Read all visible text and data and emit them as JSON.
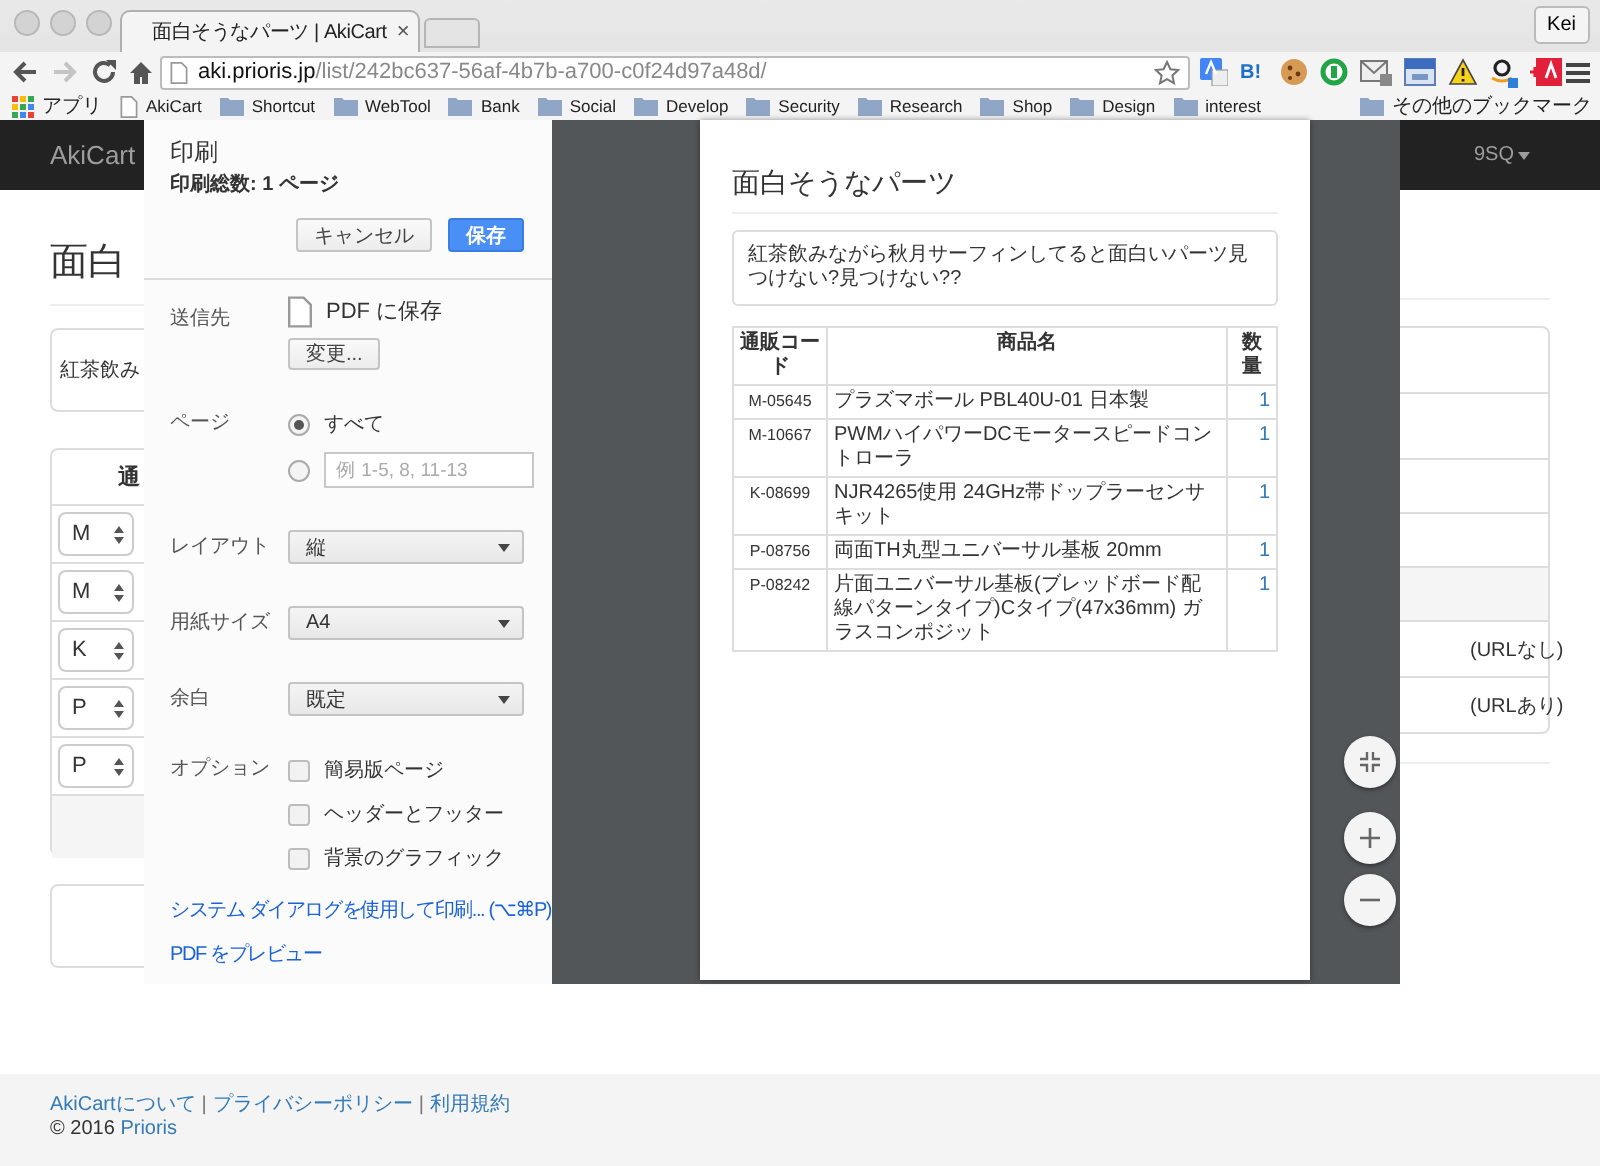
{
  "browser": {
    "tab": {
      "title": "面白そうなパーツ | AkiCart",
      "close": "×"
    },
    "profile": "Kei",
    "forward_disabled": true,
    "address": {
      "host": "aki.prioris.jp",
      "path": "/list/242bc637-56af-4b7b-a700-c0f24d97a48d/"
    },
    "extensions": [
      {
        "kind": "translate"
      },
      {
        "kind": "hatena",
        "label": "B!"
      },
      {
        "kind": "cookie"
      },
      {
        "kind": "ring"
      },
      {
        "kind": "mail"
      },
      {
        "kind": "calendar"
      },
      {
        "kind": "warning"
      },
      {
        "kind": "smile"
      },
      {
        "kind": "redtag"
      }
    ],
    "bookmarks": [
      {
        "kind": "apps",
        "label": "アプリ"
      },
      {
        "kind": "page",
        "label": "AkiCart"
      },
      {
        "kind": "folder",
        "label": "Shortcut"
      },
      {
        "kind": "folder",
        "label": "WebTool"
      },
      {
        "kind": "folder",
        "label": "Bank"
      },
      {
        "kind": "folder",
        "label": "Social"
      },
      {
        "kind": "folder",
        "label": "Develop"
      },
      {
        "kind": "folder",
        "label": "Security"
      },
      {
        "kind": "folder",
        "label": "Research"
      },
      {
        "kind": "folder",
        "label": "Shop"
      },
      {
        "kind": "folder",
        "label": "Design"
      },
      {
        "kind": "folder",
        "label": "interest"
      }
    ],
    "other_bookmarks": "その他のブックマーク"
  },
  "page": {
    "brand": "AkiCart",
    "user_menu": "9SQ",
    "title": "面白",
    "description": "紅茶飲み",
    "table_header": "通",
    "codes": [
      "M",
      "M",
      "K",
      "P",
      "P"
    ],
    "notes": [
      "(URLなし)",
      "(URLあり)"
    ],
    "footer": {
      "items": [
        {
          "kind": "link",
          "text": "AkiCartについて"
        },
        {
          "kind": "separator",
          "text": "|"
        },
        {
          "kind": "link",
          "text": "プライバシーポリシー"
        },
        {
          "kind": "separator",
          "text": "|"
        },
        {
          "kind": "link",
          "text": "利用規約"
        }
      ],
      "copyright": "© 2016",
      "company": "Prioris"
    }
  },
  "print": {
    "title": "印刷",
    "total": "印刷総数: 1 ページ",
    "buttons": [
      {
        "label": "キャンセル",
        "primary": false
      },
      {
        "label": "保存",
        "primary": true
      }
    ],
    "destination": {
      "label": "送信先",
      "value": "PDF に保存",
      "change": "変更..."
    },
    "pages": {
      "label": "ページ",
      "options": [
        {
          "label": "すべて",
          "selected": true
        },
        {
          "placeholder": "例 1-5, 8, 11-13",
          "selected": false
        }
      ]
    },
    "selects": [
      {
        "label": "レイアウト",
        "value": "縦"
      },
      {
        "label": "用紙サイズ",
        "value": "A4"
      },
      {
        "label": "余白",
        "value": "既定"
      }
    ],
    "options": {
      "label": "オプション",
      "items": [
        {
          "label": "簡易版ページ",
          "checked": false
        },
        {
          "label": "ヘッダーとフッター",
          "checked": false
        },
        {
          "label": "背景のグラフィック",
          "checked": false
        }
      ]
    },
    "links": [
      "システム ダイアログを使用して印刷... (⌥⌘P)",
      "PDF をプレビュー"
    ]
  },
  "preview": {
    "title": "面白そうなパーツ",
    "description": "紅茶飲みながら秋月サーフィンしてると面白いパーツ見つけない?見つけない??",
    "columns": [
      "通販コード",
      "商品名",
      "数量"
    ],
    "rows": [
      {
        "code": "M-05645",
        "name": "プラズマボール PBL40U-01 日本製",
        "qty": "1"
      },
      {
        "code": "M-10667",
        "name": "PWMハイパワーDCモータースピードコントローラ",
        "qty": "1"
      },
      {
        "code": "K-08699",
        "name": "NJR4265使用 24GHz帯ドップラーセンサキット",
        "qty": "1"
      },
      {
        "code": "P-08756",
        "name": "両面TH丸型ユニバーサル基板 20mm",
        "qty": "1"
      },
      {
        "code": "P-08242",
        "name": "片面ユニバーサル基板(ブレッドボード配線パターンタイプ)Cタイプ(47x36mm) ガラスコンポジット",
        "qty": "1"
      }
    ]
  }
}
